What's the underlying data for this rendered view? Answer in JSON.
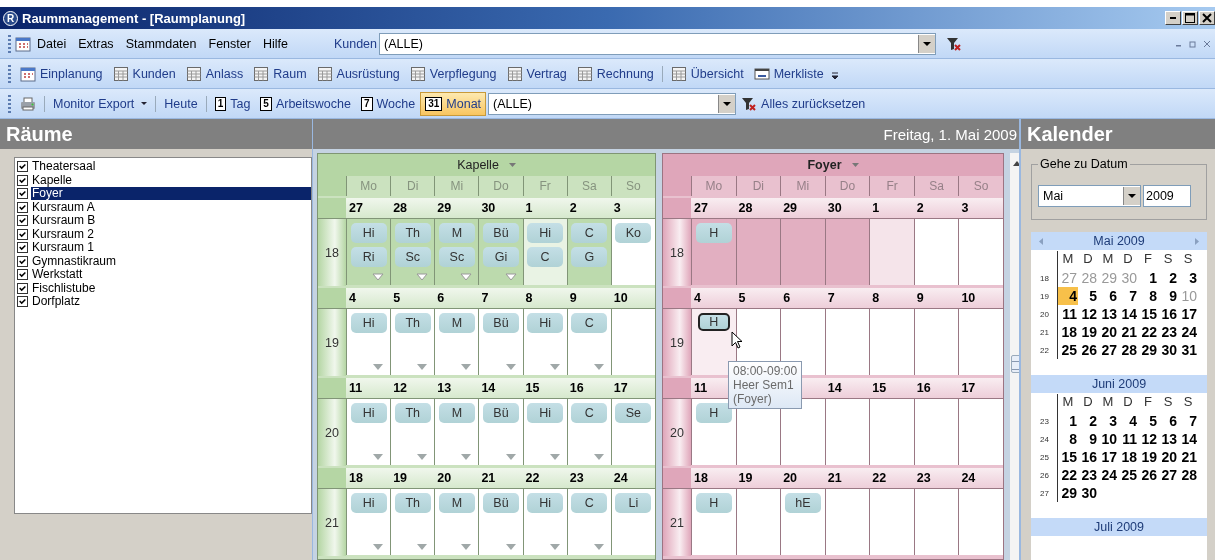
{
  "window": {
    "title": "Raummanagement - [Raumplanung]",
    "logo": "R"
  },
  "menu": [
    "Datei",
    "Extras",
    "Stammdaten",
    "Fenster",
    "Hilfe"
  ],
  "customer_filter": {
    "label": "Kunden",
    "value": "(ALLE)"
  },
  "toolbar": [
    {
      "kind": "planner",
      "label": "Einplanung"
    },
    {
      "kind": "grid",
      "label": "Kunden"
    },
    {
      "kind": "grid",
      "label": "Anlass"
    },
    {
      "kind": "grid",
      "label": "Raum"
    },
    {
      "kind": "grid",
      "label": "Ausrüstung"
    },
    {
      "kind": "grid",
      "label": "Verpflegung"
    },
    {
      "kind": "grid",
      "label": "Vertrag"
    },
    {
      "kind": "grid",
      "label": "Rechnung"
    },
    {
      "kind": "separator"
    },
    {
      "kind": "grid",
      "label": "Übersicht"
    },
    {
      "kind": "list",
      "label": "Merkliste"
    }
  ],
  "view_toolbar": {
    "items": [
      {
        "kind": "print"
      },
      {
        "kind": "dropdown",
        "label": "Monitor Export",
        "selected": false
      },
      {
        "kind": "link",
        "label": "Heute",
        "selected": false
      },
      {
        "kind": "view",
        "badge": "1",
        "label": "Tag",
        "selected": false
      },
      {
        "kind": "view",
        "badge": "5",
        "label": "Arbeitswoche",
        "selected": false
      },
      {
        "kind": "view",
        "badge": "7",
        "label": "Woche",
        "selected": false
      },
      {
        "kind": "view",
        "badge": "31",
        "label": "Monat",
        "selected": true
      }
    ],
    "filter": "(ALLE)",
    "reset": "Alles zurücksetzen"
  },
  "rooms_panel": {
    "title": "Räume",
    "items": [
      {
        "label": "Theatersaal",
        "checked": true,
        "selected": false
      },
      {
        "label": "Kapelle",
        "checked": true,
        "selected": false
      },
      {
        "label": "Foyer",
        "checked": true,
        "selected": true
      },
      {
        "label": "Kursraum A",
        "checked": true,
        "selected": false
      },
      {
        "label": "Kursraum B",
        "checked": true,
        "selected": false
      },
      {
        "label": "Kursraum 2",
        "checked": true,
        "selected": false
      },
      {
        "label": "Kursraum 1",
        "checked": true,
        "selected": false
      },
      {
        "label": "Gymnastikraum",
        "checked": true,
        "selected": false
      },
      {
        "label": "Werkstatt",
        "checked": true,
        "selected": false
      },
      {
        "label": "Fischlistube",
        "checked": true,
        "selected": false
      },
      {
        "label": "Dorfplatz",
        "checked": true,
        "selected": false
      }
    ]
  },
  "schedule": {
    "date": "Freitag, 1. Mai 2009",
    "rooms": [
      {
        "name": "Kapelle",
        "color": "#b5d6a4",
        "weekdays": [
          "Mo",
          "Di",
          "Mi",
          "Do",
          "Fr",
          "Sa",
          "So"
        ],
        "weeks": [
          {
            "week": "18",
            "days": [
              {
                "date": "27",
                "kind": "other",
                "events": [
                  "Hi",
                  "Ri"
                ],
                "more": true
              },
              {
                "date": "28",
                "kind": "other",
                "events": [
                  "Th",
                  "Sc"
                ],
                "more": true
              },
              {
                "date": "29",
                "kind": "other",
                "events": [
                  "M",
                  "Sc"
                ],
                "more": true
              },
              {
                "date": "30",
                "kind": "other",
                "events": [
                  "Bü",
                  "Gi"
                ],
                "more": true
              },
              {
                "date": "1",
                "kind": "today",
                "events": [
                  "Hi",
                  "C"
                ],
                "more": false
              },
              {
                "date": "2",
                "kind": "other",
                "events": [
                  "C",
                  "G"
                ],
                "more": false
              },
              {
                "date": "3",
                "kind": "normal",
                "events": [
                  "Ko"
                ],
                "more": false
              }
            ]
          },
          {
            "week": "19",
            "days": [
              {
                "date": "4",
                "kind": "normal",
                "events": [
                  "Hi"
                ],
                "more": true
              },
              {
                "date": "5",
                "kind": "normal",
                "events": [
                  "Th"
                ],
                "more": true
              },
              {
                "date": "6",
                "kind": "normal",
                "events": [
                  "M"
                ],
                "more": true
              },
              {
                "date": "7",
                "kind": "normal",
                "events": [
                  "Bü"
                ],
                "more": true
              },
              {
                "date": "8",
                "kind": "normal",
                "events": [
                  "Hi"
                ],
                "more": true
              },
              {
                "date": "9",
                "kind": "normal",
                "events": [
                  "C"
                ],
                "more": true
              },
              {
                "date": "10",
                "kind": "normal",
                "more": false
              }
            ]
          },
          {
            "week": "20",
            "days": [
              {
                "date": "11",
                "kind": "normal",
                "events": [
                  "Hi"
                ],
                "more": true
              },
              {
                "date": "12",
                "kind": "normal",
                "events": [
                  "Th"
                ],
                "more": true
              },
              {
                "date": "13",
                "kind": "normal",
                "events": [
                  "M"
                ],
                "more": true
              },
              {
                "date": "14",
                "kind": "normal",
                "events": [
                  "Bü"
                ],
                "more": true
              },
              {
                "date": "15",
                "kind": "normal",
                "events": [
                  "Hi"
                ],
                "more": true
              },
              {
                "date": "16",
                "kind": "normal",
                "events": [
                  "C"
                ],
                "more": true
              },
              {
                "date": "17",
                "kind": "normal",
                "events": [
                  "Se"
                ],
                "more": false
              }
            ]
          },
          {
            "week": "21",
            "days": [
              {
                "date": "18",
                "kind": "normal",
                "events": [
                  "Hi"
                ],
                "more": true
              },
              {
                "date": "19",
                "kind": "normal",
                "events": [
                  "Th"
                ],
                "more": true
              },
              {
                "date": "20",
                "kind": "normal",
                "events": [
                  "M"
                ],
                "more": true
              },
              {
                "date": "21",
                "kind": "normal",
                "events": [
                  "Bü"
                ],
                "more": true
              },
              {
                "date": "22",
                "kind": "normal",
                "events": [
                  "Hi"
                ],
                "more": true
              },
              {
                "date": "23",
                "kind": "normal",
                "events": [
                  "C"
                ],
                "more": true
              },
              {
                "date": "24",
                "kind": "normal",
                "events": [
                  "Li"
                ],
                "more": false
              }
            ]
          }
        ]
      },
      {
        "name": "Foyer",
        "color": "#dfa6ba",
        "weekdays": [
          "Mo",
          "Di",
          "Mi",
          "Do",
          "Fr",
          "Sa",
          "So"
        ],
        "weeks": [
          {
            "week": "18",
            "days": [
              {
                "date": "27",
                "kind": "other",
                "events": [
                  "H"
                ],
                "more": false
              },
              {
                "date": "28",
                "kind": "other",
                "more": false
              },
              {
                "date": "29",
                "kind": "other",
                "more": false
              },
              {
                "date": "30",
                "kind": "other",
                "more": false
              },
              {
                "date": "1",
                "kind": "today",
                "more": false
              },
              {
                "date": "2",
                "kind": "normal",
                "more": false
              },
              {
                "date": "3",
                "kind": "normal",
                "more": false
              }
            ]
          },
          {
            "week": "19",
            "days": [
              {
                "date": "4",
                "kind": "hover",
                "events": [
                  "H"
                ],
                "more": false
              },
              {
                "date": "5",
                "kind": "normal",
                "more": false
              },
              {
                "date": "6",
                "kind": "normal",
                "more": false
              },
              {
                "date": "7",
                "kind": "normal",
                "more": false
              },
              {
                "date": "8",
                "kind": "normal",
                "more": false
              },
              {
                "date": "9",
                "kind": "normal",
                "more": false
              },
              {
                "date": "10",
                "kind": "normal",
                "more": false
              }
            ]
          },
          {
            "week": "20",
            "days": [
              {
                "date": "11",
                "kind": "normal",
                "events": [
                  "H"
                ],
                "more": false
              },
              {
                "kind": "normal",
                "more": false
              },
              {
                "kind": "normal",
                "more": false
              },
              {
                "date": "14",
                "kind": "normal",
                "more": false
              },
              {
                "date": "15",
                "kind": "normal",
                "more": false
              },
              {
                "date": "16",
                "kind": "normal",
                "more": false
              },
              {
                "date": "17",
                "kind": "normal",
                "more": false
              }
            ]
          },
          {
            "week": "21",
            "days": [
              {
                "date": "18",
                "kind": "normal",
                "events": [
                  "H"
                ],
                "more": false
              },
              {
                "date": "19",
                "kind": "normal",
                "more": false
              },
              {
                "date": "20",
                "kind": "normal",
                "events": [
                  "hE"
                ],
                "more": false
              },
              {
                "date": "21",
                "kind": "normal",
                "more": false
              },
              {
                "date": "22",
                "kind": "normal",
                "more": false
              },
              {
                "date": "23",
                "kind": "normal",
                "more": false
              },
              {
                "date": "24",
                "kind": "normal",
                "more": false
              }
            ]
          }
        ],
        "tooltip": [
          "08:00-09:00",
          "Heer Sem1",
          "(Foyer)"
        ]
      }
    ]
  },
  "calendar": {
    "title": "Kalender",
    "goto": {
      "legend": "Gehe zu Datum",
      "month": "Mai",
      "year": "2009"
    },
    "months": [
      {
        "title": "Mai 2009",
        "weekdays": [
          "M",
          "D",
          "M",
          "D",
          "F",
          "S",
          "S"
        ],
        "weeks": [
          {
            "week": "18",
            "days": [
              {
                "d": "27",
                "kind": "muted"
              },
              {
                "d": "28",
                "kind": "muted"
              },
              {
                "d": "29",
                "kind": "muted"
              },
              {
                "d": "30",
                "kind": "muted"
              },
              {
                "d": "1",
                "kind": "day"
              },
              {
                "d": "2",
                "kind": "day"
              },
              {
                "d": "3",
                "kind": "day"
              }
            ]
          },
          {
            "week": "19",
            "days": [
              {
                "d": "4",
                "kind": "today"
              },
              {
                "d": "5",
                "kind": "day"
              },
              {
                "d": "6",
                "kind": "day"
              },
              {
                "d": "7",
                "kind": "day"
              },
              {
                "d": "8",
                "kind": "day"
              },
              {
                "d": "9",
                "kind": "day"
              },
              {
                "d": "10",
                "kind": "muted"
              }
            ]
          },
          {
            "week": "20",
            "days": [
              {
                "d": "11",
                "kind": "day"
              },
              {
                "d": "12",
                "kind": "day"
              },
              {
                "d": "13",
                "kind": "day"
              },
              {
                "d": "14",
                "kind": "day"
              },
              {
                "d": "15",
                "kind": "day"
              },
              {
                "d": "16",
                "kind": "day"
              },
              {
                "d": "17",
                "kind": "day"
              }
            ]
          },
          {
            "week": "21",
            "days": [
              {
                "d": "18",
                "kind": "day"
              },
              {
                "d": "19",
                "kind": "day"
              },
              {
                "d": "20",
                "kind": "day"
              },
              {
                "d": "21",
                "kind": "day"
              },
              {
                "d": "22",
                "kind": "day"
              },
              {
                "d": "23",
                "kind": "day"
              },
              {
                "d": "24",
                "kind": "day"
              }
            ]
          },
          {
            "week": "22",
            "days": [
              {
                "d": "25",
                "kind": "day"
              },
              {
                "d": "26",
                "kind": "day"
              },
              {
                "d": "27",
                "kind": "day"
              },
              {
                "d": "28",
                "kind": "day"
              },
              {
                "d": "29",
                "kind": "day"
              },
              {
                "d": "30",
                "kind": "day"
              },
              {
                "d": "31",
                "kind": "day"
              }
            ]
          }
        ]
      },
      {
        "title": "Juni 2009",
        "weekdays": [
          "M",
          "D",
          "M",
          "D",
          "F",
          "S",
          "S"
        ],
        "weeks": [
          {
            "week": "23",
            "days": [
              {
                "d": "1",
                "kind": "day"
              },
              {
                "d": "2",
                "kind": "day"
              },
              {
                "d": "3",
                "kind": "day"
              },
              {
                "d": "4",
                "kind": "day"
              },
              {
                "d": "5",
                "kind": "day"
              },
              {
                "d": "6",
                "kind": "day"
              },
              {
                "d": "7",
                "kind": "day"
              }
            ]
          },
          {
            "week": "24",
            "days": [
              {
                "d": "8",
                "kind": "day"
              },
              {
                "d": "9",
                "kind": "day"
              },
              {
                "d": "10",
                "kind": "day"
              },
              {
                "d": "11",
                "kind": "day"
              },
              {
                "d": "12",
                "kind": "day"
              },
              {
                "d": "13",
                "kind": "day"
              },
              {
                "d": "14",
                "kind": "day"
              }
            ]
          },
          {
            "week": "25",
            "days": [
              {
                "d": "15",
                "kind": "day"
              },
              {
                "d": "16",
                "kind": "day"
              },
              {
                "d": "17",
                "kind": "day"
              },
              {
                "d": "18",
                "kind": "day"
              },
              {
                "d": "19",
                "kind": "day"
              },
              {
                "d": "20",
                "kind": "day"
              },
              {
                "d": "21",
                "kind": "day"
              }
            ]
          },
          {
            "week": "26",
            "days": [
              {
                "d": "22",
                "kind": "day"
              },
              {
                "d": "23",
                "kind": "day"
              },
              {
                "d": "24",
                "kind": "day"
              },
              {
                "d": "25",
                "kind": "day"
              },
              {
                "d": "26",
                "kind": "day"
              },
              {
                "d": "27",
                "kind": "day"
              },
              {
                "d": "28",
                "kind": "day"
              }
            ]
          },
          {
            "week": "27",
            "days": [
              {
                "d": "29",
                "kind": "day"
              },
              {
                "d": "30",
                "kind": "day"
              }
            ]
          }
        ]
      },
      {
        "title": "Juli 2009"
      }
    ]
  }
}
